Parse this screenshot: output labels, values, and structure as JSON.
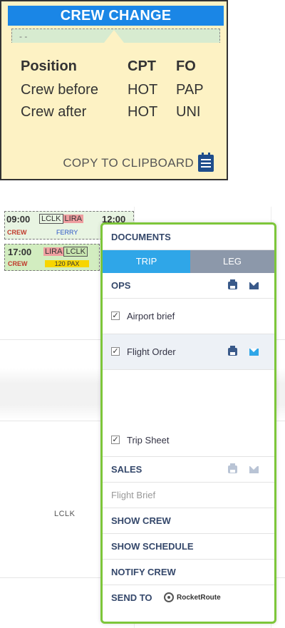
{
  "crew_change": {
    "title": "CREW CHANGE",
    "headers": [
      "Position",
      "CPT",
      "FO"
    ],
    "rows": [
      [
        "Crew before",
        "HOT",
        "PAP"
      ],
      [
        "Crew after",
        "HOT",
        "UNI"
      ]
    ],
    "copy_label": "COPY TO CLIPBOARD",
    "header_color": "#1a86e6",
    "background_color": "#fdf2c4"
  },
  "calendar": {
    "flight1": {
      "time": "09:00",
      "dep": "LCLK",
      "arr": "LIRA",
      "next_time": "12:00",
      "crew": "CREW",
      "note": "FERRY"
    },
    "flight2": {
      "time": "17:00",
      "dep": "LIRA",
      "arr": "LCLK",
      "crew": "CREW",
      "note": "120 PAX"
    },
    "lclk_label": "LCLK"
  },
  "menu": {
    "documents": "DOCUMENTS",
    "tab_trip": "TRIP",
    "tab_leg": "LEG",
    "ops": "OPS",
    "airport_brief": "Airport brief",
    "flight_order": "Flight Order",
    "trip_sheet": "Trip Sheet",
    "sales": "SALES",
    "flight_brief": "Flight Brief",
    "show_crew": "SHOW CREW",
    "show_schedule": "SHOW SCHEDULE",
    "notify_crew": "NOTIFY CREW",
    "send_to": "SEND TO",
    "rocketroute": "RocketRoute",
    "border_color": "#7dc63a",
    "active_tab_color": "#2fa6e8"
  }
}
